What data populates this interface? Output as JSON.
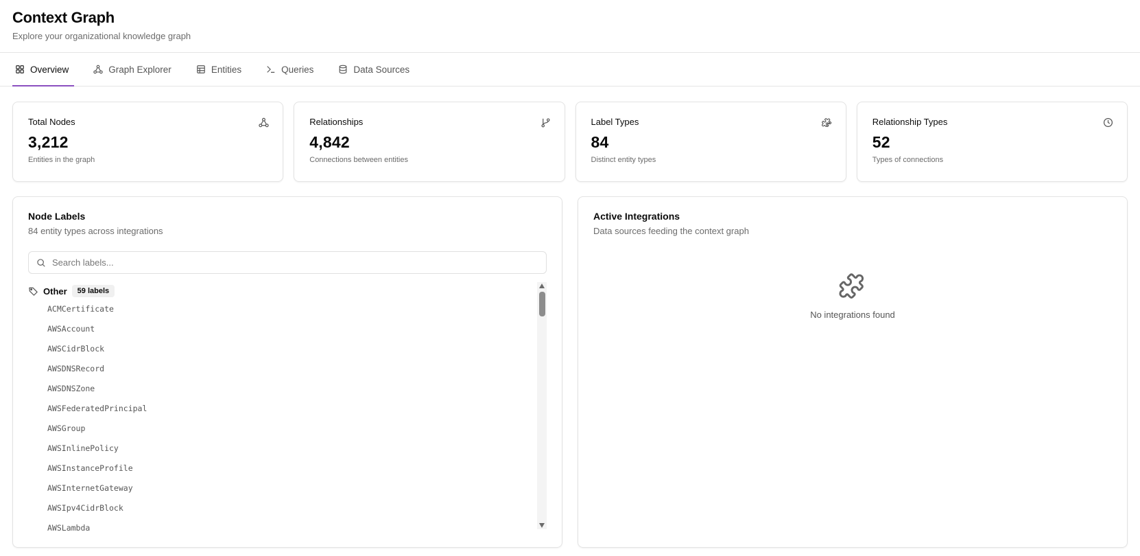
{
  "header": {
    "title": "Context Graph",
    "subtitle": "Explore your organizational knowledge graph"
  },
  "tabs": [
    {
      "label": "Overview",
      "icon": "grid-icon",
      "active": true
    },
    {
      "label": "Graph Explorer",
      "icon": "graph-nodes-icon",
      "active": false
    },
    {
      "label": "Entities",
      "icon": "table-icon",
      "active": false
    },
    {
      "label": "Queries",
      "icon": "terminal-icon",
      "active": false
    },
    {
      "label": "Data Sources",
      "icon": "database-icon",
      "active": false
    }
  ],
  "stats": [
    {
      "title": "Total Nodes",
      "value": "3,212",
      "desc": "Entities in the graph",
      "icon": "graph-nodes-icon"
    },
    {
      "title": "Relationships",
      "value": "4,842",
      "desc": "Connections between entities",
      "icon": "git-branch-icon"
    },
    {
      "title": "Label Types",
      "value": "84",
      "desc": "Distinct entity types",
      "icon": "puzzle-icon"
    },
    {
      "title": "Relationship Types",
      "value": "52",
      "desc": "Types of connections",
      "icon": "clock-icon"
    }
  ],
  "node_labels": {
    "title": "Node Labels",
    "subtitle": "84 entity types across integrations",
    "search_placeholder": "Search labels...",
    "group": {
      "name": "Other",
      "count": "59 labels",
      "items": [
        "ACMCertificate",
        "AWSAccount",
        "AWSCidrBlock",
        "AWSDNSRecord",
        "AWSDNSZone",
        "AWSFederatedPrincipal",
        "AWSGroup",
        "AWSInlinePolicy",
        "AWSInstanceProfile",
        "AWSInternetGateway",
        "AWSIpv4CidrBlock",
        "AWSLambda"
      ]
    }
  },
  "integrations": {
    "title": "Active Integrations",
    "subtitle": "Data sources feeding the context graph",
    "empty_text": "No integrations found",
    "empty_icon": "puzzle-icon"
  },
  "colors": {
    "accent": "#8a4fbf",
    "border": "#e3e3e3",
    "muted_text": "#6b6b6b"
  }
}
